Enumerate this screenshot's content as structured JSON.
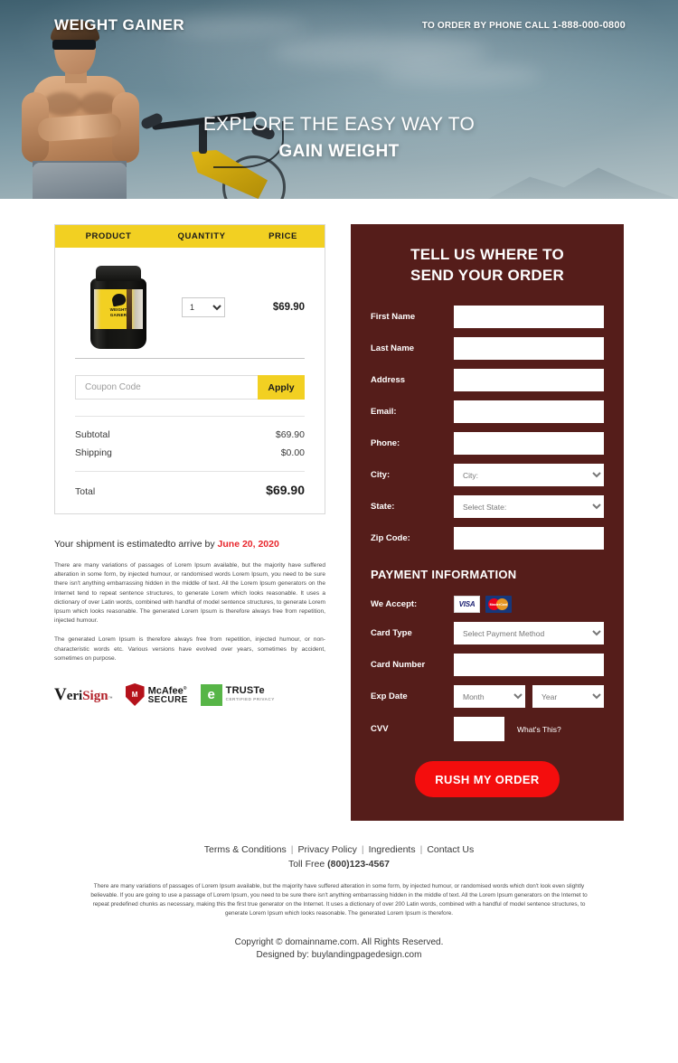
{
  "hero": {
    "logo": "WEIGHT GAINER",
    "phone_prefix": "TO ORDER BY PHONE CALL ",
    "phone_number": "1-888-000-0800",
    "headline_line1": "EXPLORE THE EASY WAY TO",
    "headline_line2": "GAIN WEIGHT"
  },
  "order": {
    "columns": {
      "product": "PRODUCT",
      "quantity": "QUANTITY",
      "price": "PRICE"
    },
    "product": {
      "label_line1": "WEIGHT",
      "label_line2": "GAINER",
      "quantity_value": "1",
      "price": "$69.90"
    },
    "coupon": {
      "placeholder": "Coupon Code",
      "value": "",
      "apply_label": "Apply"
    },
    "summary": [
      {
        "label": "Subtotal",
        "value": "$69.90"
      },
      {
        "label": "Shipping",
        "value": "$0.00"
      }
    ],
    "total": {
      "label": "Total",
      "value": "$69.90"
    }
  },
  "shipment": {
    "prefix": "Your shipment is estimatedto arrive by ",
    "date": "June 20, 2020",
    "paragraph1": "There are many variations of passages of Lorem Ipsum available, but the majority have suffered alteration in some form, by injected humour, or randomised words Lorem Ipsum, you need to be sure there isn't anything embarrassing hidden in the middle of text. All the Lorem Ipsum generators on the Internet tend to repeat sentence structures, to generate Lorem which looks reasonable. It uses a dictionary of over Latin words, combined with handful of model sentence structures, to generate Lorem Ipsum which looks reasonable. The generated Lorem Ipsum is therefore always free from repetition, injected humour.",
    "paragraph2": "The generated Lorem Ipsum is therefore always free from repetition, injected humour, or non-characteristic words etc. Various versions have evolved over years, sometimes by accident, sometimes on purpose."
  },
  "badges": {
    "verisign": {
      "v": "V",
      "eri": "eri",
      "sign": "Sign",
      "tm": "™"
    },
    "mcafee": {
      "mark": "M",
      "line1": "McAfee",
      "reg": "®",
      "line2": "SECURE"
    },
    "truste": {
      "mark": "e",
      "line1": "TRUSTe",
      "line2": "CERTIFIED PRIVACY"
    }
  },
  "form": {
    "title_line1": "TELL US WHERE TO",
    "title_line2": "SEND YOUR ORDER",
    "fields": [
      {
        "label": "First Name",
        "type": "text",
        "value": "",
        "placeholder": ""
      },
      {
        "label": "Last Name",
        "type": "text",
        "value": "",
        "placeholder": ""
      },
      {
        "label": "Address",
        "type": "text",
        "value": "",
        "placeholder": ""
      },
      {
        "label": "Email:",
        "type": "text",
        "value": "",
        "placeholder": ""
      },
      {
        "label": "Phone:",
        "type": "text",
        "value": "",
        "placeholder": ""
      },
      {
        "label": "City:",
        "type": "select",
        "value": "City:"
      },
      {
        "label": "State:",
        "type": "select",
        "value": "Select State:"
      },
      {
        "label": "Zip Code:",
        "type": "text",
        "value": "",
        "placeholder": ""
      }
    ],
    "payment": {
      "title": "PAYMENT INFORMATION",
      "we_accept_label": "We Accept:",
      "card_type_label": "Card Type",
      "card_type_value": "Select Payment Method",
      "card_number_label": "Card Number",
      "card_number_value": "",
      "exp_date_label": "Exp Date",
      "exp_month_value": "Month",
      "exp_year_value": "Year",
      "cvv_label": "CVV",
      "cvv_value": "",
      "whats_this": "What's This?",
      "visa_label": "VISA",
      "mastercard_label": "MasterCard"
    },
    "submit_label": "RUSH MY ORDER"
  },
  "footer": {
    "links": [
      "Terms & Conditions",
      "Privacy Policy",
      "Ingredients",
      "Contact Us"
    ],
    "separator": "|",
    "toll_free_label": "Toll Free ",
    "toll_free_number": "(800)123-4567",
    "disclaimer": "There are many variations of passages of Lorem Ipsum available, but the majority have suffered alteration in some form, by injected humour, or randomised words which don't look even slightly believable. If you are going to use a passage of Lorem Ipsum, you need to be sure there isn't anything embarrassing hidden in the middle of text. All the Lorem Ipsum generators on the Internet to repeat predefined chunks as necessary, making this the first true generator on the Internet. It uses a dictionary of over 200 Latin words, combined with a handful of model sentence structures, to generate Lorem Ipsum which looks reasonable. The generated Lorem Ipsum is therefore.",
    "copyright": "Copyright © domainname.com. All Rights Reserved.",
    "designed_by": "Designed by: buylandingpagedesign.com"
  },
  "colors": {
    "accent_yellow": "#F2D022",
    "panel_maroon": "#551D1A",
    "cta_red": "#F40D0D",
    "date_red": "#E8262C"
  }
}
